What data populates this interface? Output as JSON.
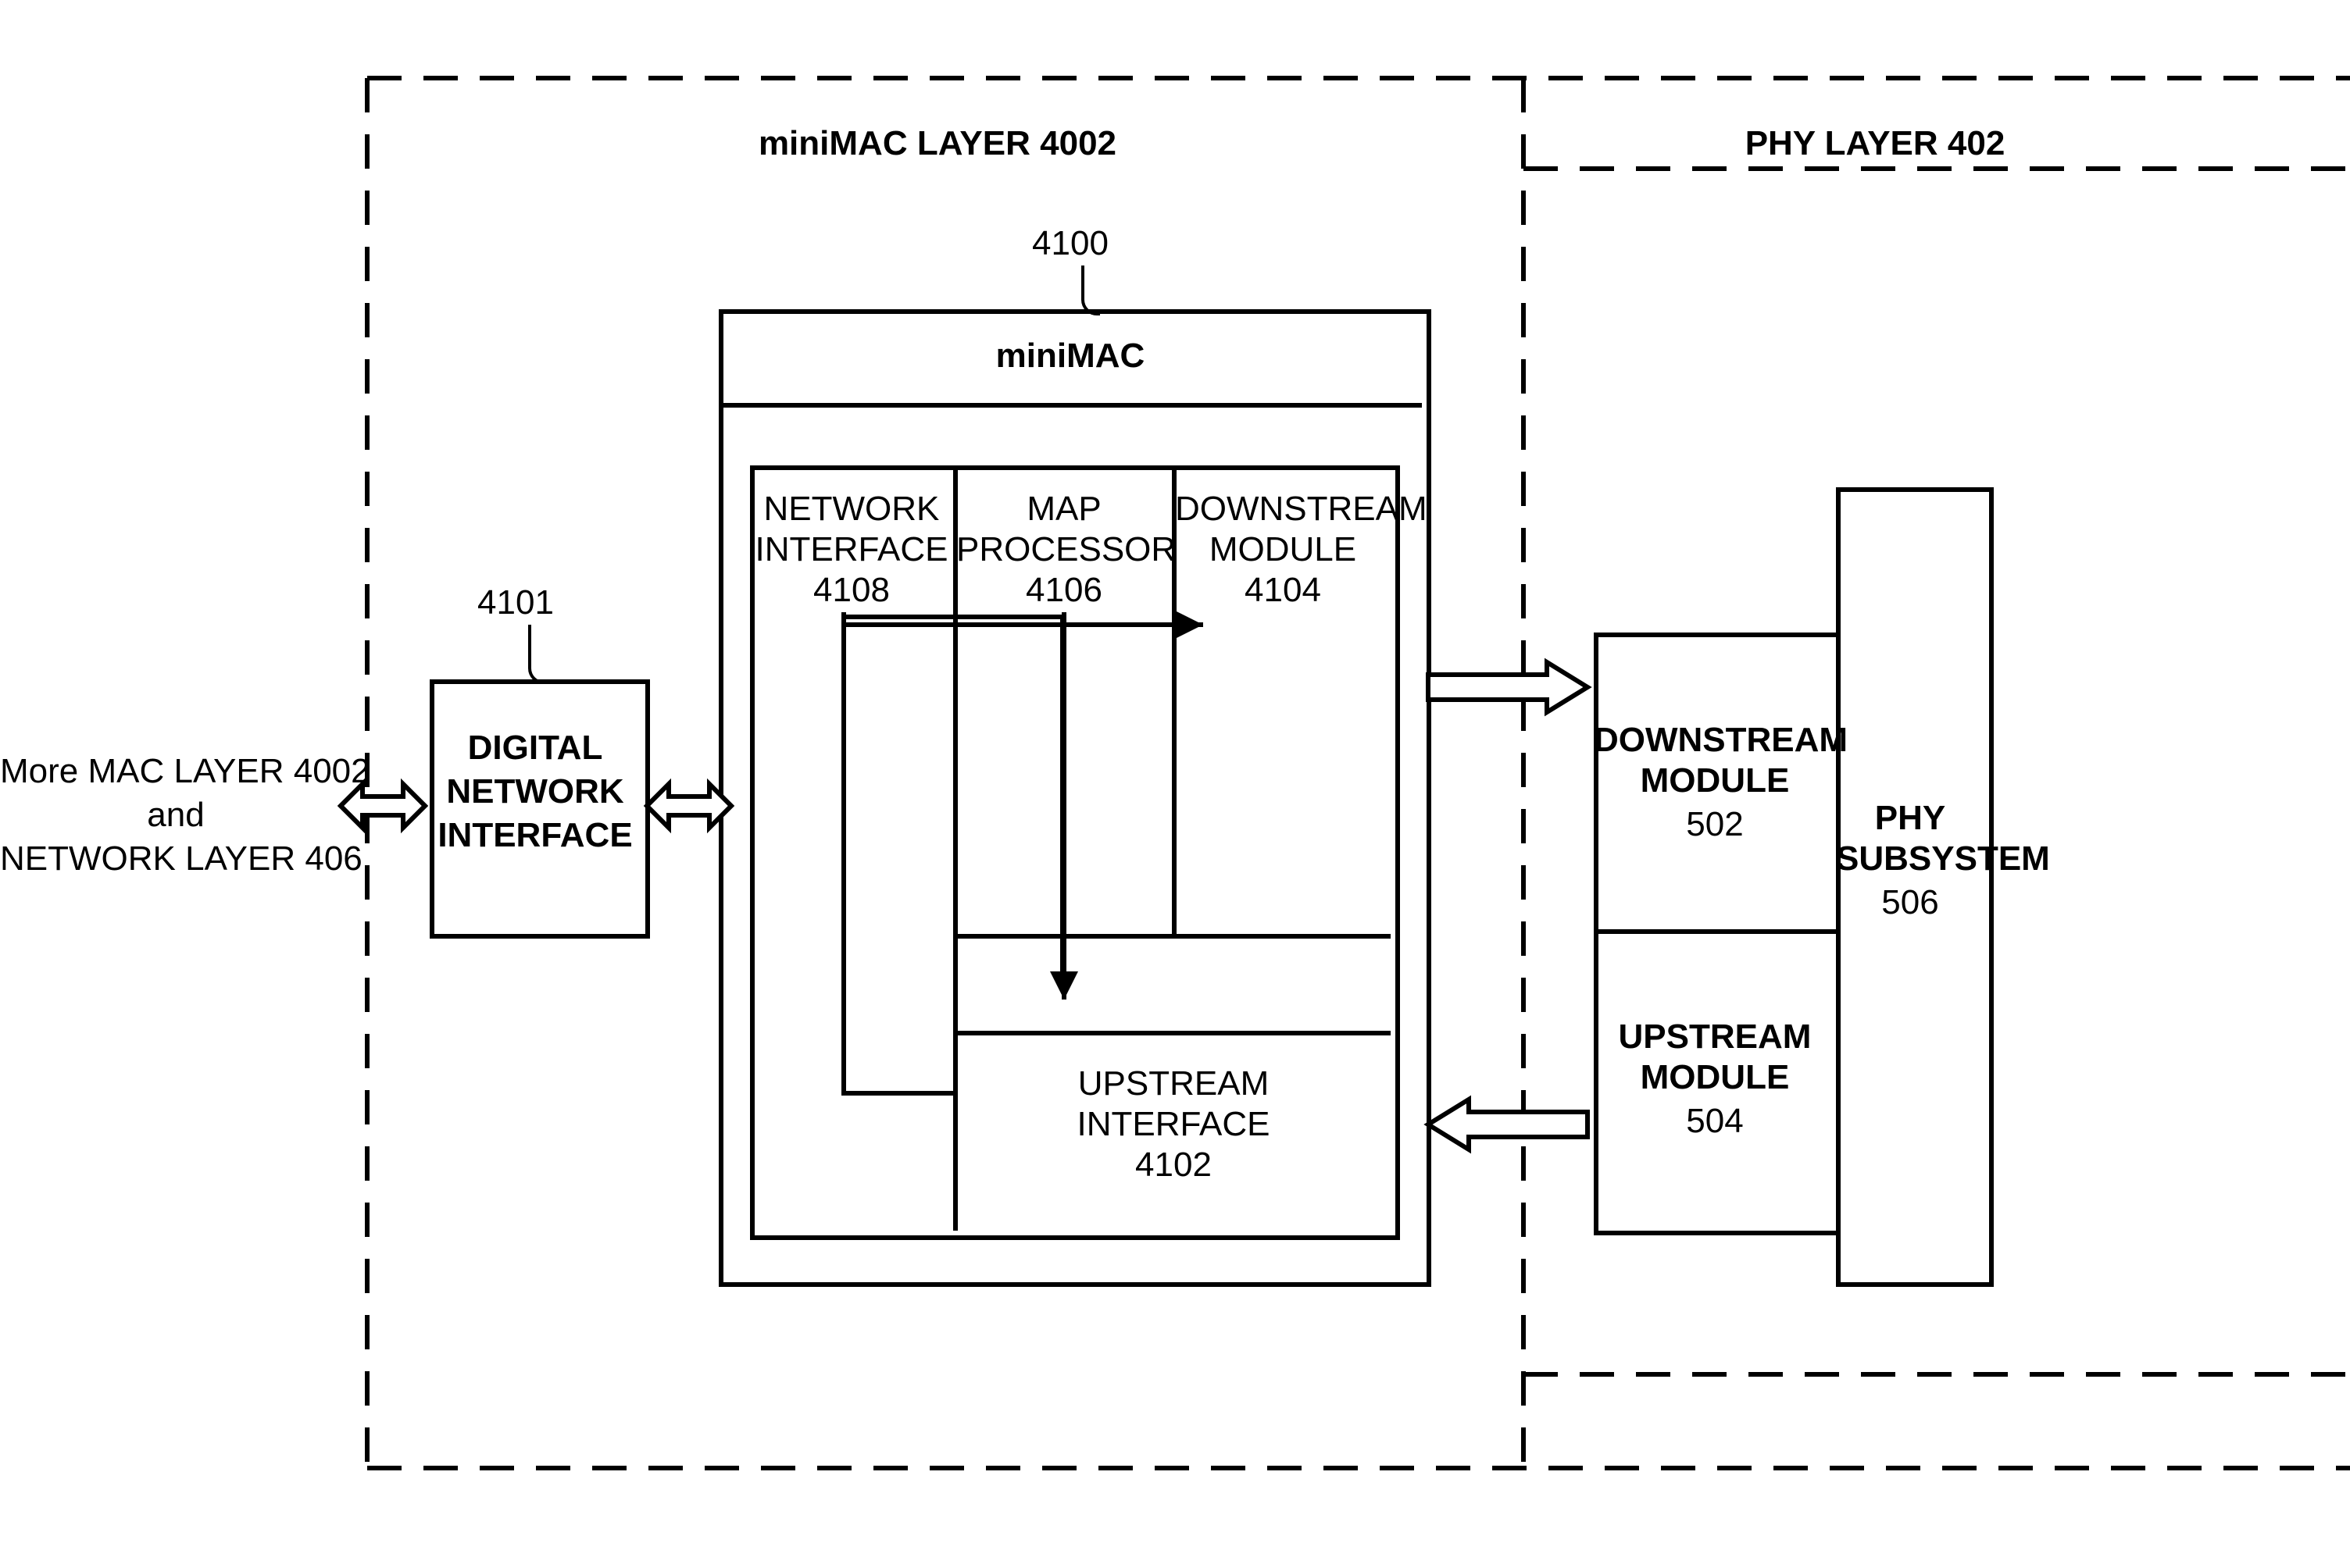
{
  "layers": {
    "minimac": {
      "title": "miniMAC LAYER 4002"
    },
    "phy": {
      "title": "PHY LAYER 402"
    }
  },
  "external": {
    "line1": "More MAC LAYER 4002",
    "line2": "and",
    "line3": "NETWORK LAYER 406"
  },
  "dni": {
    "ref": "4101",
    "line1": "DIGITAL",
    "line2": "NETWORK",
    "line3": "INTERFACE"
  },
  "minimac_block": {
    "ref": "4100",
    "title": "miniMAC",
    "network_if": {
      "l1": "NETWORK",
      "l2": "INTERFACE",
      "l3": "4108"
    },
    "map_proc": {
      "l1": "MAP",
      "l2": "PROCESSOR",
      "l3": "4106"
    },
    "downstream": {
      "l1": "DOWNSTREAM",
      "l2": "MODULE",
      "l3": "4104"
    },
    "upstream_if": {
      "l1": "UPSTREAM",
      "l2": "INTERFACE",
      "l3": "4102"
    }
  },
  "phy_block": {
    "down": {
      "l1": "DOWNSTREAM",
      "l2": "MODULE",
      "l3": "502"
    },
    "up": {
      "l1": "UPSTREAM",
      "l2": "MODULE",
      "l3": "504"
    },
    "sub": {
      "l1": "PHY",
      "l2": "SUBSYSTEM",
      "l3": "506"
    }
  }
}
